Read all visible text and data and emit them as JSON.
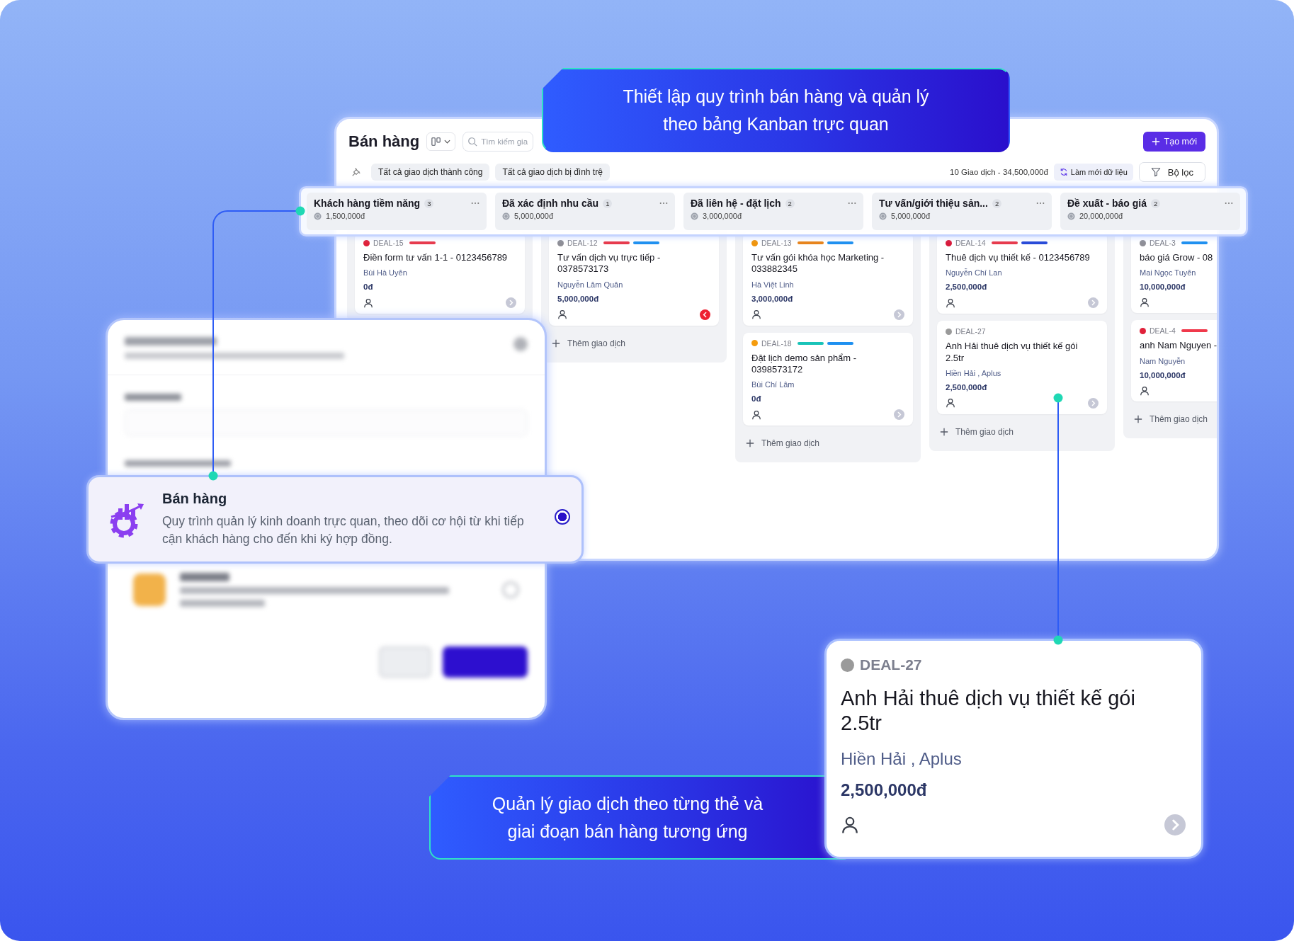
{
  "board": {
    "title": "Bán hàng",
    "search": {
      "placeholder": "Tìm kiếm gia"
    },
    "create_button": "Tạo mới",
    "quick_filters": [
      {
        "label": "Tất cả giao dịch thành công"
      },
      {
        "label": "Tất cả giao dịch bị đình trệ"
      }
    ],
    "summary": "10 Giao dịch - 34,500,000đ",
    "refresh_button": "Làm mới dữ liệu",
    "filter_button": "Bộ lọc",
    "stages": [
      {
        "title": "Khách hàng tiềm năng",
        "count": "3",
        "amount": "1,500,000đ",
        "deals": [
          {
            "code": "DEAL-15",
            "color": "#e0213a",
            "tags": [
              {
                "color": "#e8394b"
              }
            ],
            "title": "Điền form tư vấn 1-1 - 0123456789",
            "contact": "Bùi Hà Uyên",
            "amount": "0đ",
            "overdue": false
          }
        ]
      },
      {
        "title": "Đã xác định nhu cầu",
        "count": "1",
        "amount": "5,000,000đ",
        "add_label": "Thêm giao dịch",
        "deals": [
          {
            "code": "DEAL-12",
            "color": "#8e8e96",
            "tags": [
              {
                "color": "#e8394b"
              },
              {
                "color": "#1e90f0"
              }
            ],
            "title": "Tư vấn dịch vụ trực tiếp - 0378573173",
            "contact": "Nguyễn Lâm Quân",
            "amount": "5,000,000đ",
            "overdue": true
          }
        ]
      },
      {
        "title": "Đã liên hệ - đặt lịch",
        "count": "2",
        "amount": "3,000,000đ",
        "add_label": "Thêm giao dịch",
        "deals": [
          {
            "code": "DEAL-13",
            "color": "#f0950c",
            "tags": [
              {
                "color": "#e8841a"
              },
              {
                "color": "#1e90f0"
              }
            ],
            "title": "Tư vấn gói khóa học Marketing - 033882345",
            "contact": "Hà Việt Linh",
            "amount": "3,000,000đ",
            "overdue": false
          },
          {
            "code": "DEAL-18",
            "color": "#f59c0e",
            "tags": [
              {
                "color": "#19c3b8"
              },
              {
                "color": "#1e90f0"
              }
            ],
            "title": "Đặt lịch demo sản phẩm - 0398573172",
            "contact": "Bùi Chí Lâm",
            "amount": "0đ",
            "overdue": false
          }
        ]
      },
      {
        "title": "Tư vấn/giới thiệu sản...",
        "count": "2",
        "amount": "5,000,000đ",
        "add_label": "Thêm giao dịch",
        "deals": [
          {
            "code": "DEAL-14",
            "color": "#d9193a",
            "tags": [
              {
                "color": "#e8394b"
              },
              {
                "color": "#2749d8"
              }
            ],
            "title": "Thuê dịch vụ thiết kế - 0123456789",
            "contact": "Nguyễn Chí Lan",
            "amount": "2,500,000đ",
            "overdue": false
          },
          {
            "code": "DEAL-27",
            "color": "#9a9a9a",
            "title": "Anh Hải thuê dịch vụ thiết kế gói 2.5tr",
            "contact": "Hiền Hải , Aplus",
            "amount": "2,500,000đ",
            "overdue": false
          }
        ]
      },
      {
        "title": "Đề xuất - báo giá",
        "count": "2",
        "amount": "20,000,000đ",
        "add_label": "Thêm giao dịch",
        "deals": [
          {
            "code": "DEAL-3",
            "color": "#8e8e96",
            "tags": [
              {
                "color": "#1e90f0"
              }
            ],
            "title": "báo giá Grow - 08",
            "contact": "Mai Ngọc Tuyên",
            "amount": "10,000,000đ"
          },
          {
            "code": "DEAL-4",
            "color": "#e0213a",
            "tags": [
              {
                "color": "#f0394b"
              }
            ],
            "title": "anh Nam Nguyen -",
            "contact": "Nam Nguyễn",
            "amount": "10,000,000đ"
          }
        ]
      }
    ]
  },
  "kanban_callout": {
    "text": "Thiết lập quy trình bán hàng và quản lý theo bảng Kanban trực quan"
  },
  "template_option": {
    "title": "Bán hàng",
    "description": "Quy trình quản lý kinh doanh trực quan, theo dõi cơ hội từ khi tiếp cận khách hàng cho đến khi ký hợp đồng.",
    "selected": true
  },
  "card_callout": {
    "text": "Quản lý giao dịch theo từng thẻ và giai đoạn bán hàng tương ứng"
  },
  "deal_detail": {
    "code": "DEAL-27",
    "color": "#9a9a9a",
    "title": "Anh Hải thuê dịch vụ thiết kế gói 2.5tr",
    "contact": "Hiền Hải , Aplus",
    "amount": "2,500,000đ",
    "overdue": false
  }
}
